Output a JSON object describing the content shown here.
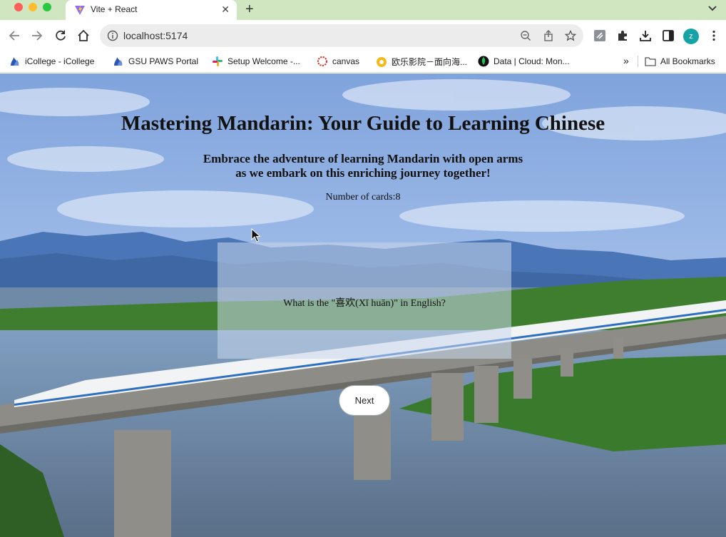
{
  "browser": {
    "tab": {
      "title": "Vite + React",
      "favicon": "vite-logo-icon"
    },
    "address_bar": {
      "url": "localhost:5174"
    },
    "profile_initial": "z",
    "bookmarks": [
      {
        "label": "iCollege - iCollege",
        "icon": "gsu-flame-icon"
      },
      {
        "label": "GSU PAWS Portal",
        "icon": "gsu-flame-icon"
      },
      {
        "label": "Setup Welcome -...",
        "icon": "slack-icon"
      },
      {
        "label": "canvas",
        "icon": "canvas-icon"
      },
      {
        "label": "欧乐影院－面向海...",
        "icon": "olevod-icon"
      },
      {
        "label": "Data | Cloud: Mon...",
        "icon": "mongodb-leaf-icon"
      }
    ],
    "all_bookmarks_label": "All Bookmarks"
  },
  "page": {
    "title": "Mastering Mandarin: Your Guide to Learning Chinese",
    "subtitle": "Embrace the adventure of learning Mandarin with open arms as we embark on this enriching journey together!",
    "card_count_label": "Number of cards:",
    "card_count": "8",
    "card": {
      "question": "What is the \"喜欢(Xǐ huān)\" in English?"
    },
    "next_label": "Next"
  },
  "colors": {
    "tabstrip": "#cfe6c0",
    "sky": "#8fb1e4",
    "mountains": "#4c78b8",
    "river": "#6d8eb0",
    "bridge": "#8a8a84",
    "train": "#f2f4f6",
    "foliage": "#3f7d2f"
  }
}
